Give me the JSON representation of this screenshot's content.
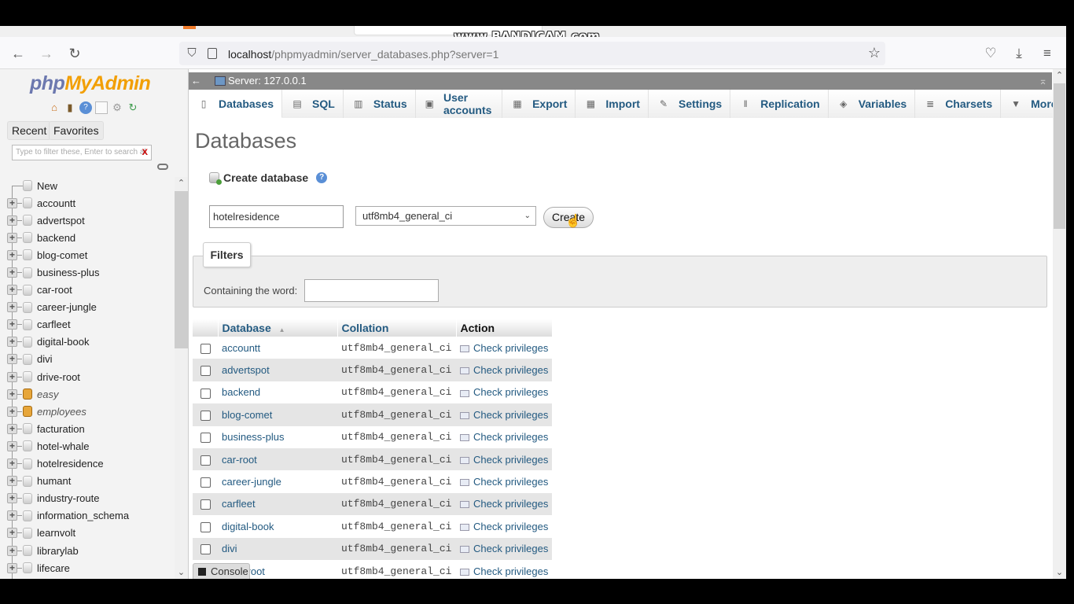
{
  "recording": {
    "watermark": "www.BANDICAM.com"
  },
  "browser": {
    "url_host": "localhost",
    "url_path": "/phpmyadmin/server_databases.php?server=1",
    "nav": {
      "back": "←",
      "forward": "→",
      "reload": "↻"
    },
    "icons": {
      "shield": "⛉",
      "star": "☆",
      "pocket": "♡",
      "download": "⤓",
      "menu": "≡"
    }
  },
  "sidebar": {
    "logo_php": "php",
    "logo_myadmin": "MyAdmin",
    "icons": [
      "home-icon",
      "logout-icon",
      "help-icon",
      "docs-icon",
      "settings-icon",
      "reload-icon"
    ],
    "recent_label": "Recent",
    "favorites_label": "Favorites",
    "filter_placeholder": "Type to filter these, Enter to search al",
    "filter_clear": "X",
    "new_label": "New",
    "databases": [
      {
        "name": "accountt",
        "readonly": false
      },
      {
        "name": "advertspot",
        "readonly": false
      },
      {
        "name": "backend",
        "readonly": false
      },
      {
        "name": "blog-comet",
        "readonly": false
      },
      {
        "name": "business-plus",
        "readonly": false
      },
      {
        "name": "car-root",
        "readonly": false
      },
      {
        "name": "career-jungle",
        "readonly": false
      },
      {
        "name": "carfleet",
        "readonly": false
      },
      {
        "name": "digital-book",
        "readonly": false
      },
      {
        "name": "divi",
        "readonly": false
      },
      {
        "name": "drive-root",
        "readonly": false
      },
      {
        "name": "easy",
        "readonly": true
      },
      {
        "name": "employees",
        "readonly": true
      },
      {
        "name": "facturation",
        "readonly": false
      },
      {
        "name": "hotel-whale",
        "readonly": false
      },
      {
        "name": "hotelresidence",
        "readonly": false
      },
      {
        "name": "humant",
        "readonly": false
      },
      {
        "name": "industry-route",
        "readonly": false
      },
      {
        "name": "information_schema",
        "readonly": false
      },
      {
        "name": "learnvolt",
        "readonly": false
      },
      {
        "name": "librarylab",
        "readonly": false
      },
      {
        "name": "lifecare",
        "readonly": false
      }
    ]
  },
  "server_bar": {
    "back": "←",
    "label": "Server: 127.0.0.1",
    "collapse": "⌅"
  },
  "menu_tabs": [
    {
      "label": "Databases",
      "icon": "database-icon",
      "glyph": "▯",
      "active": true
    },
    {
      "label": "SQL",
      "icon": "sql-icon",
      "glyph": "▤",
      "active": false
    },
    {
      "label": "Status",
      "icon": "status-icon",
      "glyph": "▥",
      "active": false
    },
    {
      "label": "User accounts",
      "icon": "user-accounts-icon",
      "glyph": "▣",
      "active": false
    },
    {
      "label": "Export",
      "icon": "export-icon",
      "glyph": "▦",
      "active": false
    },
    {
      "label": "Import",
      "icon": "import-icon",
      "glyph": "▦",
      "active": false
    },
    {
      "label": "Settings",
      "icon": "wrench-icon",
      "glyph": "✎",
      "active": false
    },
    {
      "label": "Replication",
      "icon": "replication-icon",
      "glyph": "‖",
      "active": false
    },
    {
      "label": "Variables",
      "icon": "variables-icon",
      "glyph": "◈",
      "active": false
    },
    {
      "label": "Charsets",
      "icon": "charsets-icon",
      "glyph": "≣",
      "active": false
    },
    {
      "label": "More",
      "icon": "more-caret-icon",
      "glyph": "▼",
      "active": false
    }
  ],
  "page": {
    "title": "Databases",
    "create_db_label": "Create database",
    "help": "?",
    "db_name_value": "hotelresidence",
    "collation_selected": "utf8mb4_general_ci",
    "collation_arrow": "⌄",
    "create_button": "Create"
  },
  "filters": {
    "legend": "Filters",
    "containing_label": "Containing the word:",
    "containing_value": ""
  },
  "table": {
    "headers": {
      "database": "Database",
      "sort": "▲",
      "collation": "Collation",
      "action": "Action"
    },
    "rows": [
      {
        "name": "accountt",
        "collation": "utf8mb4_general_ci",
        "action": "Check privileges"
      },
      {
        "name": "advertspot",
        "collation": "utf8mb4_general_ci",
        "action": "Check privileges"
      },
      {
        "name": "backend",
        "collation": "utf8mb4_general_ci",
        "action": "Check privileges"
      },
      {
        "name": "blog-comet",
        "collation": "utf8mb4_general_ci",
        "action": "Check privileges"
      },
      {
        "name": "business-plus",
        "collation": "utf8mb4_general_ci",
        "action": "Check privileges"
      },
      {
        "name": "car-root",
        "collation": "utf8mb4_general_ci",
        "action": "Check privileges"
      },
      {
        "name": "career-jungle",
        "collation": "utf8mb4_general_ci",
        "action": "Check privileges"
      },
      {
        "name": "carfleet",
        "collation": "utf8mb4_general_ci",
        "action": "Check privileges"
      },
      {
        "name": "digital-book",
        "collation": "utf8mb4_general_ci",
        "action": "Check privileges"
      },
      {
        "name": "divi",
        "collation": "utf8mb4_general_ci",
        "action": "Check privileges"
      },
      {
        "name": "drive-root",
        "collation": "utf8mb4_general_ci",
        "action": "Check privileges"
      }
    ]
  },
  "console": {
    "label": "Console"
  }
}
